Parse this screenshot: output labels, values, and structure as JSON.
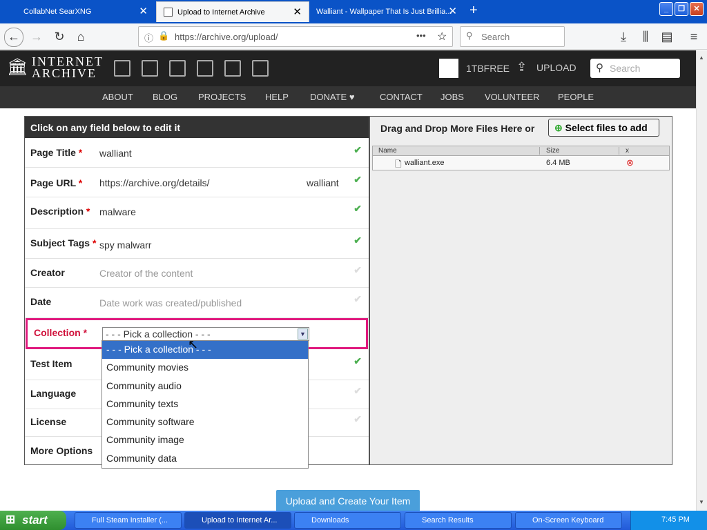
{
  "browser": {
    "tabs": [
      {
        "title": "CollabNet SearXNG"
      },
      {
        "title": "Upload to Internet Archive"
      },
      {
        "title": "Walliant - Wallpaper That Is Just Brillia..."
      }
    ],
    "url": "https://archive.org/upload/",
    "search_placeholder": "Search",
    "url_menu": "•••"
  },
  "ia": {
    "logo_line1": "INTERNET",
    "logo_line2": "ARCHIVE",
    "user": "1TBFREE",
    "upload": "UPLOAD",
    "search_placeholder": "Search",
    "menu": [
      "ABOUT",
      "BLOG",
      "PROJECTS",
      "HELP",
      "DONATE ♥",
      "CONTACT",
      "JOBS",
      "VOLUNTEER",
      "PEOPLE"
    ]
  },
  "form": {
    "header": "Click on any field below to edit it",
    "fields": [
      {
        "label": "Page Title",
        "required": "*",
        "value": "walliant"
      },
      {
        "label": "Page URL",
        "required": "*",
        "value": "https://archive.org/details/",
        "suffix": "walliant"
      },
      {
        "label": "Description",
        "required": "*",
        "value": "malware"
      },
      {
        "label": "Subject Tags",
        "required": "*",
        "value": "spy malwarr"
      },
      {
        "label": "Creator",
        "placeholder": "Creator of the content"
      },
      {
        "label": "Date",
        "placeholder": "Date work was created/published"
      },
      {
        "label": "Collection",
        "required": "*"
      },
      {
        "label": "Test Item"
      },
      {
        "label": "Language"
      },
      {
        "label": "License"
      },
      {
        "label": "More Options"
      }
    ],
    "collection_selected": "- - - Pick a collection - - -",
    "collection_options": [
      "- - - Pick a collection - - -",
      "Community movies",
      "Community audio",
      "Community texts",
      "Community software",
      "Community image",
      "Community data"
    ],
    "submit": "Upload and Create Your Item"
  },
  "files": {
    "header": "Drag and Drop More Files Here or",
    "select_button": "Select files to add",
    "columns": [
      "Name",
      "Size",
      "x"
    ],
    "rows": [
      {
        "name": "walliant.exe",
        "size": "6.4 MB"
      }
    ]
  },
  "taskbar": {
    "start": "start",
    "tasks": [
      "Full Steam Installer (...",
      "Upload to Internet Ar...",
      "Downloads",
      "Search Results",
      "On-Screen Keyboard"
    ],
    "clock": "7:45 PM"
  }
}
